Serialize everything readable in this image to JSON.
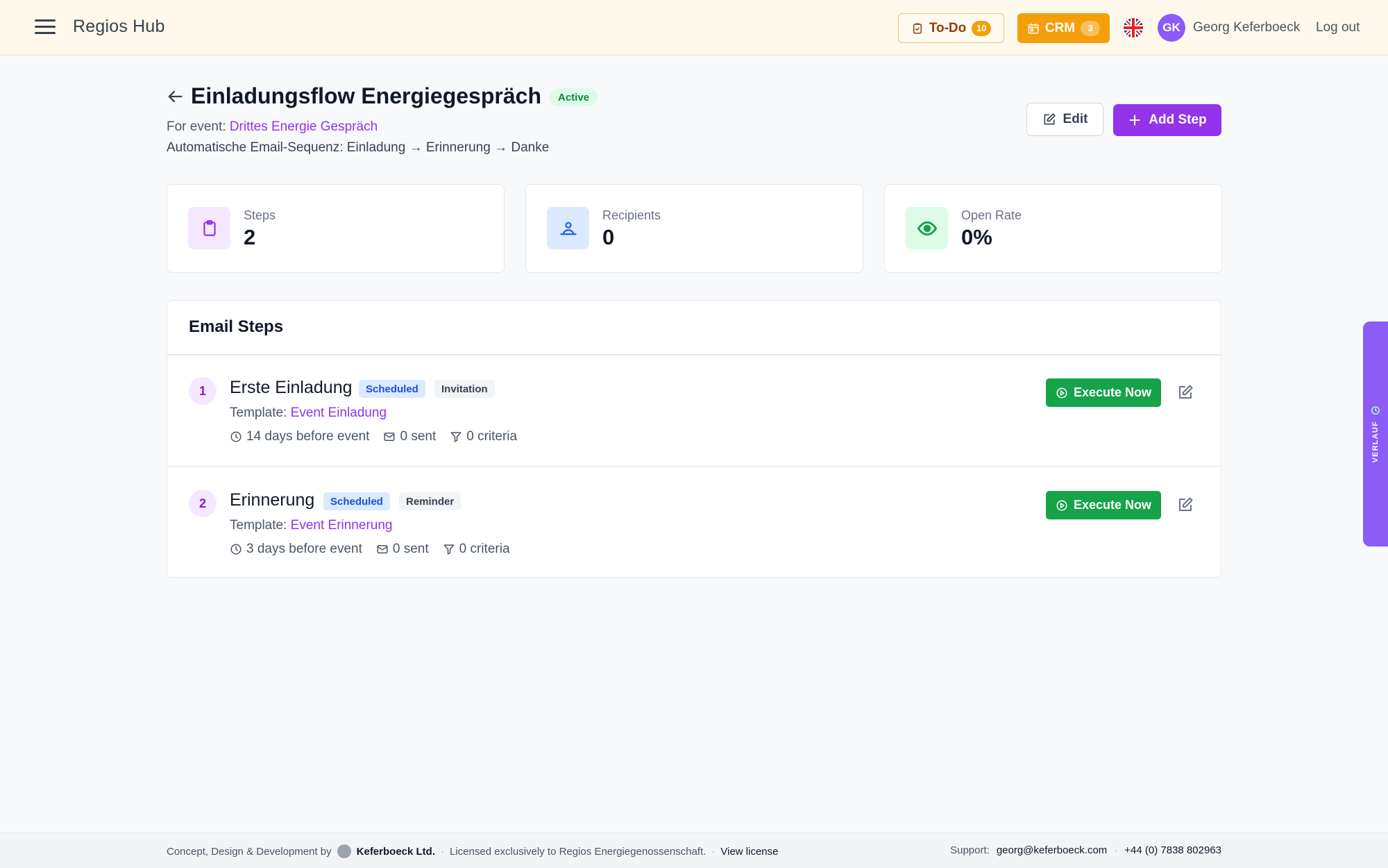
{
  "header": {
    "app_name": "Regios Hub",
    "todo_label": "To-Do",
    "todo_count": "10",
    "crm_label": "CRM",
    "crm_count": "3",
    "avatar_initials": "GK",
    "user_name": "Georg Keferboeck",
    "logout_label": "Log out"
  },
  "page": {
    "title": "Einladungsflow Energiegespräch",
    "status": "Active",
    "event_prefix": "For event:",
    "event_name": "Drittes Energie Gespräch",
    "description": "Automatische Email-Sequenz: Einladung → Erinnerung → Danke",
    "edit_label": "Edit",
    "add_step_label": "Add Step"
  },
  "stats": [
    {
      "label": "Steps",
      "value": "2",
      "icon": "clipboard-icon"
    },
    {
      "label": "Recipients",
      "value": "0",
      "icon": "users-icon"
    },
    {
      "label": "Open Rate",
      "value": "0%",
      "icon": "eye-icon"
    }
  ],
  "steps_panel": {
    "heading": "Email Steps",
    "steps": [
      {
        "number": "1",
        "name": "Erste Einladung",
        "status": "Scheduled",
        "type": "Invitation",
        "template_prefix": "Template:",
        "template_name": "Event Einladung",
        "timing": "14 days before event",
        "sent": "0 sent",
        "criteria": "0 criteria",
        "execute_label": "Execute Now"
      },
      {
        "number": "2",
        "name": "Erinnerung",
        "status": "Scheduled",
        "type": "Reminder",
        "template_prefix": "Template:",
        "template_name": "Event Erinnerung",
        "timing": "3 days before event",
        "sent": "0 sent",
        "criteria": "0 criteria",
        "execute_label": "Execute Now"
      }
    ]
  },
  "side_tab": {
    "label": "VERLAUF"
  },
  "footer": {
    "credit": "Concept, Design & Development by",
    "company": "Keferboeck Ltd.",
    "license_text": "Licensed exclusively to Regios Energiegenossenschaft.",
    "view_license": "View license",
    "support_label": "Support:",
    "support_email": "georg@keferboeck.com",
    "phone": "+44 (0) 7838 802963"
  },
  "colors": {
    "primary_purple": "#9333ea",
    "crm_orange": "#f59e0b",
    "execute_green": "#16a34a",
    "header_bg": "#fef9ec"
  }
}
